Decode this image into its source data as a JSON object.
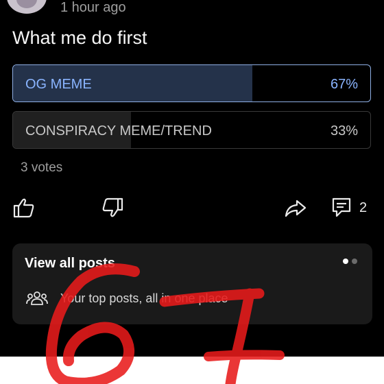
{
  "post": {
    "time": "1 hour ago",
    "title": "What me do first"
  },
  "poll": {
    "options": [
      {
        "label": "OG MEME",
        "percent": "67%",
        "fraction": 0.67
      },
      {
        "label": "CONSPIRACY MEME/TREND",
        "percent": "33%",
        "fraction": 0.33
      }
    ],
    "votes": "3 votes"
  },
  "actions": {
    "comment_count": "2",
    "icons": [
      "thumbs-up-icon",
      "thumbs-down-icon",
      "share-icon",
      "comment-icon"
    ]
  },
  "card": {
    "title": "View all posts",
    "text": "Your top posts, all in one place",
    "icon": "people-icon"
  },
  "colors": {
    "accent": "#8ab4ff",
    "selected_fill": "#24324a",
    "background": "#000000",
    "card_bg": "#1a1a1a",
    "scribble": "#e81b1b"
  }
}
